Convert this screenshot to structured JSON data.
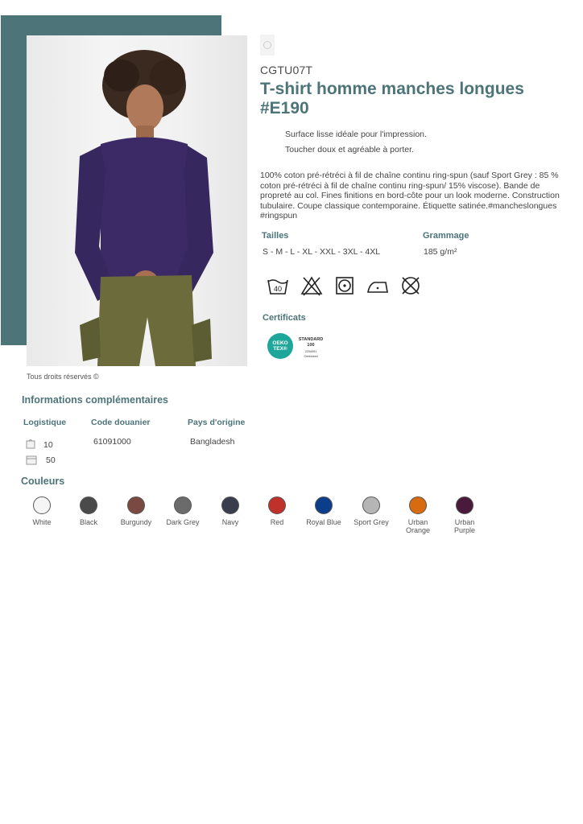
{
  "product": {
    "reference": "CGTU07T",
    "title": "T-shirt homme manches longues #E190",
    "bullets": [
      "Surface lisse idéale pour l'impression.",
      "Toucher doux et agréable à porter."
    ],
    "description": "100% coton pré-rétréci à fil de chaîne continu ring-spun (sauf Sport Grey : 85 % coton pré-rétréci à fil de chaîne continu ring-spun/ 15% viscose). Bande de propreté au col. Fines finitions en bord-côte pour un look moderne. Construction tubulaire. Coupe classique contemporaine. Étiquette satinée.#mancheslongues #ringspun",
    "photo_credit": "Tous droits réservés ©"
  },
  "specs": {
    "sizes_label": "Tailles",
    "sizes_value": "S - M - L - XL - XXL - 3XL - 4XL",
    "weight_label": "Grammage",
    "weight_value": "185 g/m²",
    "wash_temperature": "40",
    "care_icons": [
      "wash-40-icon",
      "no-bleach-icon",
      "tumble-dry-icon",
      "iron-low-icon",
      "no-dry-clean-icon"
    ],
    "certificates_label": "Certificats",
    "certificate": {
      "badge_line1": "OEKO",
      "badge_line2": "TEX®",
      "standard": "STANDARD",
      "number": "100",
      "code": "2204091",
      "institute": "Centexbel"
    }
  },
  "extra": {
    "title": "Informations complémentaires",
    "logistics_label": "Logistique",
    "logistics_values": [
      "10",
      "50"
    ],
    "customs_label": "Code douanier",
    "customs_value": "61091000",
    "origin_label": "Pays d'origine",
    "origin_value": "Bangladesh"
  },
  "colors": {
    "title": "Couleurs",
    "items": [
      {
        "name": "White",
        "hex": "#f5f5f5"
      },
      {
        "name": "Black",
        "hex": "#4a4a4a"
      },
      {
        "name": "Burgundy",
        "hex": "#7a4a42"
      },
      {
        "name": "Dark Grey",
        "hex": "#6b6b6b"
      },
      {
        "name": "Navy",
        "hex": "#3a3d4c"
      },
      {
        "name": "Red",
        "hex": "#c0312b"
      },
      {
        "name": "Royal Blue",
        "hex": "#0a3e8a"
      },
      {
        "name": "Sport Grey",
        "hex": "#b5b5b5"
      },
      {
        "name": "Urban Orange",
        "hex": "#d86a10"
      },
      {
        "name": "Urban Purple",
        "hex": "#4a1a3a"
      }
    ]
  },
  "accent_color": "#4d7479"
}
